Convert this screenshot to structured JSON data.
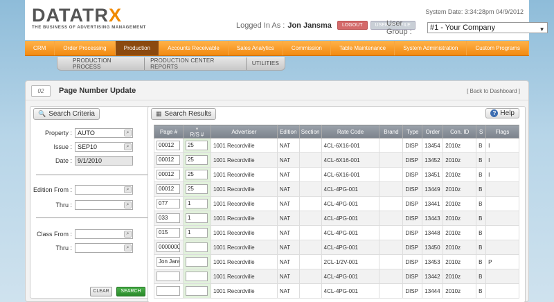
{
  "header": {
    "logo_main": "DATATR",
    "logo_x": "X",
    "logo_tag": "THE BUSINESS OF ADVERTISING MANAGEMENT",
    "system_date": "System Date: 3:34:28pm 04/9/2012",
    "logged_in_label": "Logged In As :",
    "user_name": "Jon Jansma",
    "logout_label": "LOGOUT",
    "profile_label": "USER PROFILE",
    "user_group_label": "User Group :",
    "user_group_value": "#1 - Your Company"
  },
  "nav": {
    "items": [
      "CRM",
      "Order Processing",
      "Production",
      "Accounts Receivable",
      "Sales Analytics",
      "Commission",
      "Table Maintenance",
      "System Administration",
      "Custom Programs"
    ],
    "active": "Production"
  },
  "subnav": {
    "items": [
      "PRODUCTION PROCESS",
      "PRODUCTION CENTER REPORTS",
      "UTILITIES"
    ]
  },
  "page": {
    "icon_text": "02",
    "title": "Page Number Update",
    "back_link": "[ Back to Dashboard ]"
  },
  "criteria": {
    "tab_label": "Search Criteria",
    "property_label": "Property :",
    "property_value": "AUTO",
    "issue_label": "Issue :",
    "issue_value": "SEP10",
    "date_label": "Date :",
    "date_value": "9/1/2010",
    "edition_from_label": "Edition From :",
    "edition_thru_label": "Thru :",
    "class_from_label": "Class From :",
    "class_thru_label": "Thru :",
    "clear_label": "CLEAR",
    "search_label": "SEARCH"
  },
  "results": {
    "tab_label": "Search Results",
    "help_label": "Help",
    "columns": [
      "Page #",
      "R/S #",
      "Advertiser",
      "Edition",
      "Section",
      "Rate Code",
      "Brand",
      "Type",
      "Order",
      "Con. ID",
      "S",
      "Flags"
    ],
    "rows": [
      {
        "page": "00012",
        "rs": "25",
        "advertiser": "1001 Recordville",
        "edition": "NAT",
        "section": "",
        "rate_code": "4CL-6X16-001",
        "brand": "",
        "type": "DISP",
        "order": "13454",
        "con_id": "2010z",
        "s": "B",
        "flags": "I"
      },
      {
        "page": "00012",
        "rs": "25",
        "advertiser": "1001 Recordville",
        "edition": "NAT",
        "section": "",
        "rate_code": "4CL-6X16-001",
        "brand": "",
        "type": "DISP",
        "order": "13452",
        "con_id": "2010z",
        "s": "B",
        "flags": "I"
      },
      {
        "page": "00012",
        "rs": "25",
        "advertiser": "1001 Recordville",
        "edition": "NAT",
        "section": "",
        "rate_code": "4CL-6X16-001",
        "brand": "",
        "type": "DISP",
        "order": "13451",
        "con_id": "2010z",
        "s": "B",
        "flags": "I"
      },
      {
        "page": "00012",
        "rs": "25",
        "advertiser": "1001 Recordville",
        "edition": "NAT",
        "section": "",
        "rate_code": "4CL-4PG-001",
        "brand": "",
        "type": "DISP",
        "order": "13449",
        "con_id": "2010z",
        "s": "B",
        "flags": ""
      },
      {
        "page": "077",
        "rs": "1",
        "advertiser": "1001 Recordville",
        "edition": "NAT",
        "section": "",
        "rate_code": "4CL-4PG-001",
        "brand": "",
        "type": "DISP",
        "order": "13441",
        "con_id": "2010z",
        "s": "B",
        "flags": ""
      },
      {
        "page": "033",
        "rs": "1",
        "advertiser": "1001 Recordville",
        "edition": "NAT",
        "section": "",
        "rate_code": "4CL-4PG-001",
        "brand": "",
        "type": "DISP",
        "order": "13443",
        "con_id": "2010z",
        "s": "B",
        "flags": ""
      },
      {
        "page": "015",
        "rs": "1",
        "advertiser": "1001 Recordville",
        "edition": "NAT",
        "section": "",
        "rate_code": "4CL-4PG-001",
        "brand": "",
        "type": "DISP",
        "order": "13448",
        "con_id": "2010z",
        "s": "B",
        "flags": ""
      },
      {
        "page": "0000000",
        "rs": "",
        "advertiser": "1001 Recordville",
        "edition": "NAT",
        "section": "",
        "rate_code": "4CL-4PG-001",
        "brand": "",
        "type": "DISP",
        "order": "13450",
        "con_id": "2010z",
        "s": "B",
        "flags": ""
      },
      {
        "page": "Jon Jans",
        "rs": "",
        "advertiser": "1001 Recordville",
        "edition": "NAT",
        "section": "",
        "rate_code": "2CL-1/2V-001",
        "brand": "",
        "type": "DISP",
        "order": "13453",
        "con_id": "2010z",
        "s": "B",
        "flags": "P"
      },
      {
        "page": "",
        "rs": "",
        "advertiser": "1001 Recordville",
        "edition": "NAT",
        "section": "",
        "rate_code": "4CL-4PG-001",
        "brand": "",
        "type": "DISP",
        "order": "13442",
        "con_id": "2010z",
        "s": "B",
        "flags": ""
      },
      {
        "page": "",
        "rs": "",
        "advertiser": "1001 Recordville",
        "edition": "NAT",
        "section": "",
        "rate_code": "4CL-4PG-001",
        "brand": "",
        "type": "DISP",
        "order": "13444",
        "con_id": "2010z",
        "s": "B",
        "flags": ""
      }
    ]
  }
}
